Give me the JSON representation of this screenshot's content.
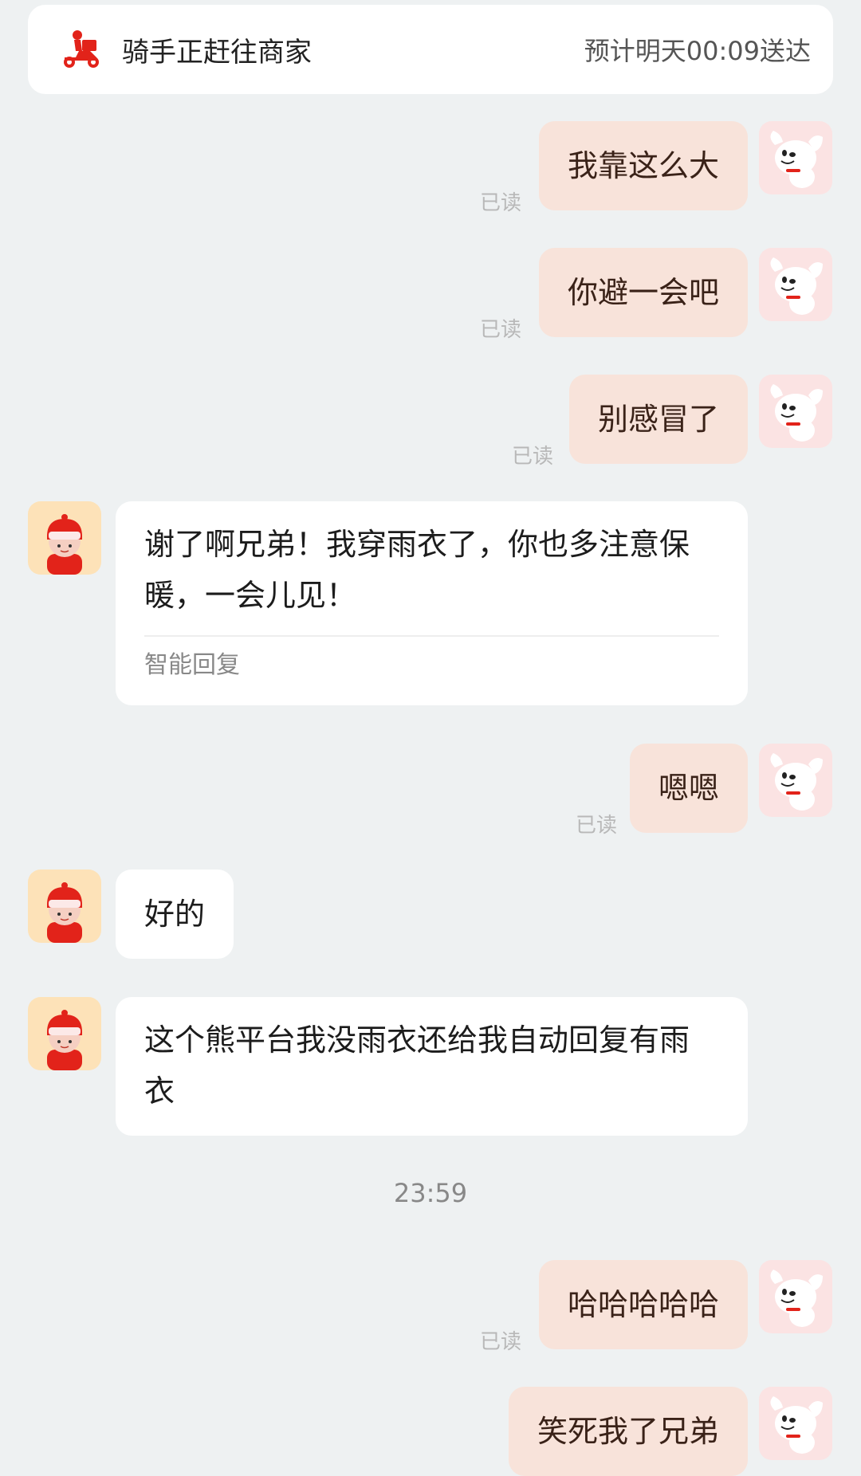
{
  "status_card": {
    "status": "骑手正赶往商家",
    "eta": "预计明天00:09送达"
  },
  "messages": [
    {
      "text": "我靠这么大",
      "read": "已读"
    },
    {
      "text": "你避一会吧",
      "read": "已读"
    },
    {
      "text": "别感冒了",
      "read": "已读"
    },
    {
      "text": "谢了啊兄弟！我穿雨衣了，你也多注意保暖，一会儿见！",
      "tag": "智能回复"
    },
    {
      "text": "嗯嗯",
      "read": "已读"
    },
    {
      "text": "好的"
    },
    {
      "text": "这个熊平台我没雨衣还给我自动回复有雨衣"
    },
    {
      "text": "哈哈哈哈哈",
      "read": "已读"
    },
    {
      "text": "笑死我了兄弟"
    }
  ],
  "timestamp": "23:59",
  "colors": {
    "background": "#eef1f2",
    "outgoing_bubble": "#f8e3da",
    "incoming_bubble": "#ffffff",
    "brand_red": "#e2231a"
  },
  "icons": {
    "status": "delivery-scooter-icon",
    "self_avatar": "jd-dog-mascot-icon",
    "rider_avatar": "rider-avatar-icon"
  }
}
